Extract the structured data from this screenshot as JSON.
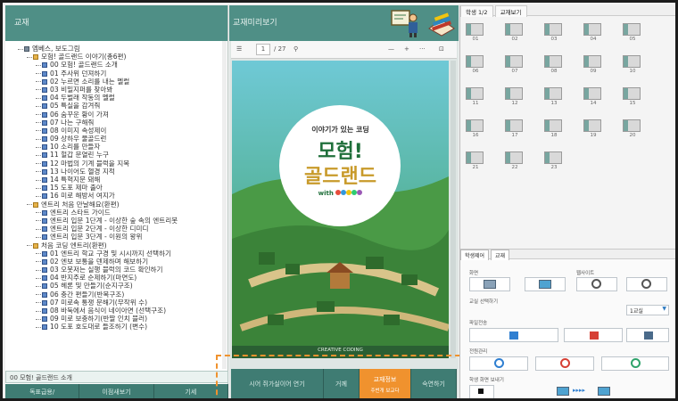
{
  "left_panel": {
    "header": "교재",
    "tree": [
      {
        "text": "엠베스, 보도그림",
        "level": 0,
        "icon": "folder-icon"
      },
      {
        "text": "모험! 골드랜드 이야기(총6편)",
        "level": 1,
        "icon": "folder-icon"
      },
      {
        "text": "00 모험! 골드랜드 소개",
        "level": 2,
        "icon": "doc-icon"
      },
      {
        "text": "01 주사위 던져하기",
        "level": 2,
        "icon": "doc-icon"
      },
      {
        "text": "02 누르면 소리를 내는 멜럴",
        "level": 2,
        "icon": "doc-icon"
      },
      {
        "text": "03 비밀지퍼를 찾아봐",
        "level": 2,
        "icon": "doc-icon"
      },
      {
        "text": "04 두벌래 작동의 멜럴",
        "level": 2,
        "icon": "doc-icon"
      },
      {
        "text": "05 특실을 감겨줘",
        "level": 2,
        "icon": "doc-icon"
      },
      {
        "text": "06 숨꾸운 황이 가져",
        "level": 2,
        "icon": "doc-icon"
      },
      {
        "text": "07 나는 구해줘",
        "level": 2,
        "icon": "doc-icon"
      },
      {
        "text": "08 이미지 속성제이",
        "level": 2,
        "icon": "doc-icon"
      },
      {
        "text": "09 상하우 물골드런",
        "level": 2,
        "icon": "doc-icon"
      },
      {
        "text": "10 소리를 만들자",
        "level": 2,
        "icon": "doc-icon"
      },
      {
        "text": "11 헐갑 문열린 누구",
        "level": 2,
        "icon": "doc-icon"
      },
      {
        "text": "12 마법의 기계 블럭을 지목",
        "level": 2,
        "icon": "doc-icon"
      },
      {
        "text": "13 나이어도 헬경 지적",
        "level": 2,
        "icon": "doc-icon"
      },
      {
        "text": "14 특혁지문 돼해",
        "level": 2,
        "icon": "doc-icon"
      },
      {
        "text": "15 도포 제마 출아",
        "level": 2,
        "icon": "doc-icon"
      },
      {
        "text": "16 미로 해방서 여지가",
        "level": 2,
        "icon": "doc-icon"
      },
      {
        "text": "엔트리 처음 만날해요(환편)",
        "level": 1,
        "icon": "folder-icon"
      },
      {
        "text": "엔트리 스타트 가이드",
        "level": 2,
        "icon": "doc-icon"
      },
      {
        "text": "엔트리 입문 1단계 - 이상한 숲 속의 엔트리봇",
        "level": 2,
        "icon": "doc-icon"
      },
      {
        "text": "엔트리 입문 2단계 - 이상한 디미디",
        "level": 2,
        "icon": "doc-icon"
      },
      {
        "text": "엔트리 입문 3단계 - 이원의 왕위",
        "level": 2,
        "icon": "doc-icon"
      },
      {
        "text": "처음 코딩 엔트리(환편)",
        "level": 1,
        "icon": "folder-icon"
      },
      {
        "text": "01 엔트리 학교 구경 및 시시까지 선택하기",
        "level": 2,
        "icon": "doc-icon"
      },
      {
        "text": "02 엔보 보통을 덴제하며 해보하기",
        "level": 2,
        "icon": "doc-icon"
      },
      {
        "text": "03 오봇저는 실행 블럭의 코드 확인하기",
        "level": 2,
        "icon": "doc-icon"
      },
      {
        "text": "04 반지주로 순제하기(마면도)",
        "level": 2,
        "icon": "doc-icon"
      },
      {
        "text": "05 헤론 및 만들기(순지구조)",
        "level": 2,
        "icon": "doc-icon"
      },
      {
        "text": "06 충간 편들기(반복구조)",
        "level": 2,
        "icon": "doc-icon"
      },
      {
        "text": "07 미로속 통쟁 문해기(무작위 수)",
        "level": 2,
        "icon": "doc-icon"
      },
      {
        "text": "08 바둑에서 음식이 네이아면 (선택구조)",
        "level": 2,
        "icon": "doc-icon"
      },
      {
        "text": "09 미로 보충하기(반딸 인치 블러)",
        "level": 2,
        "icon": "doc-icon"
      },
      {
        "text": "10 도포 호도대로 들조하기 (변수)",
        "level": 2,
        "icon": "doc-icon"
      }
    ],
    "selected_title": "00 모험! 골드랜드 소개",
    "buttons": [
      "독표급용/",
      "이점새보기",
      "기세"
    ]
  },
  "mid_panel": {
    "header": "교재미리보기",
    "toolbar": {
      "page_input": "1",
      "page_total": "/ 27"
    },
    "book": {
      "kicker": "이야기가 있는 코딩",
      "title_1": "모험!",
      "title_2": "골드랜드",
      "with": "with",
      "footer": "CREATIVE CODING"
    },
    "buttons": {
      "b1": "시어 쥐가실이어 연기",
      "b2": "거께",
      "b3_line1": "교재정보",
      "b3_line2": "주번개 보교다",
      "b4": "숙연하기"
    }
  },
  "right_panel": {
    "tabs": [
      "학생 1/2",
      "교재보기"
    ],
    "thumbnails": [
      "01",
      "02",
      "03",
      "04",
      "05",
      "06",
      "07",
      "08",
      "09",
      "10",
      "11",
      "12",
      "13",
      "14",
      "15",
      "16",
      "17",
      "18",
      "19",
      "20",
      "21",
      "22",
      "23"
    ],
    "control_tabs": [
      "학생제어",
      "교재"
    ],
    "labels": {
      "screen": "화면",
      "web": "웹사이트",
      "class_select": "교실 선택하기",
      "transfer": "파일전송",
      "power": "전원관리",
      "send_screen": "학생 화면 보내기"
    },
    "class_select_value": "1교실"
  },
  "colors": {
    "accent": "#4f8f86",
    "dark_accent": "#3f7c73",
    "highlight": "#f0922e",
    "book_green": "#2c7a4f"
  }
}
